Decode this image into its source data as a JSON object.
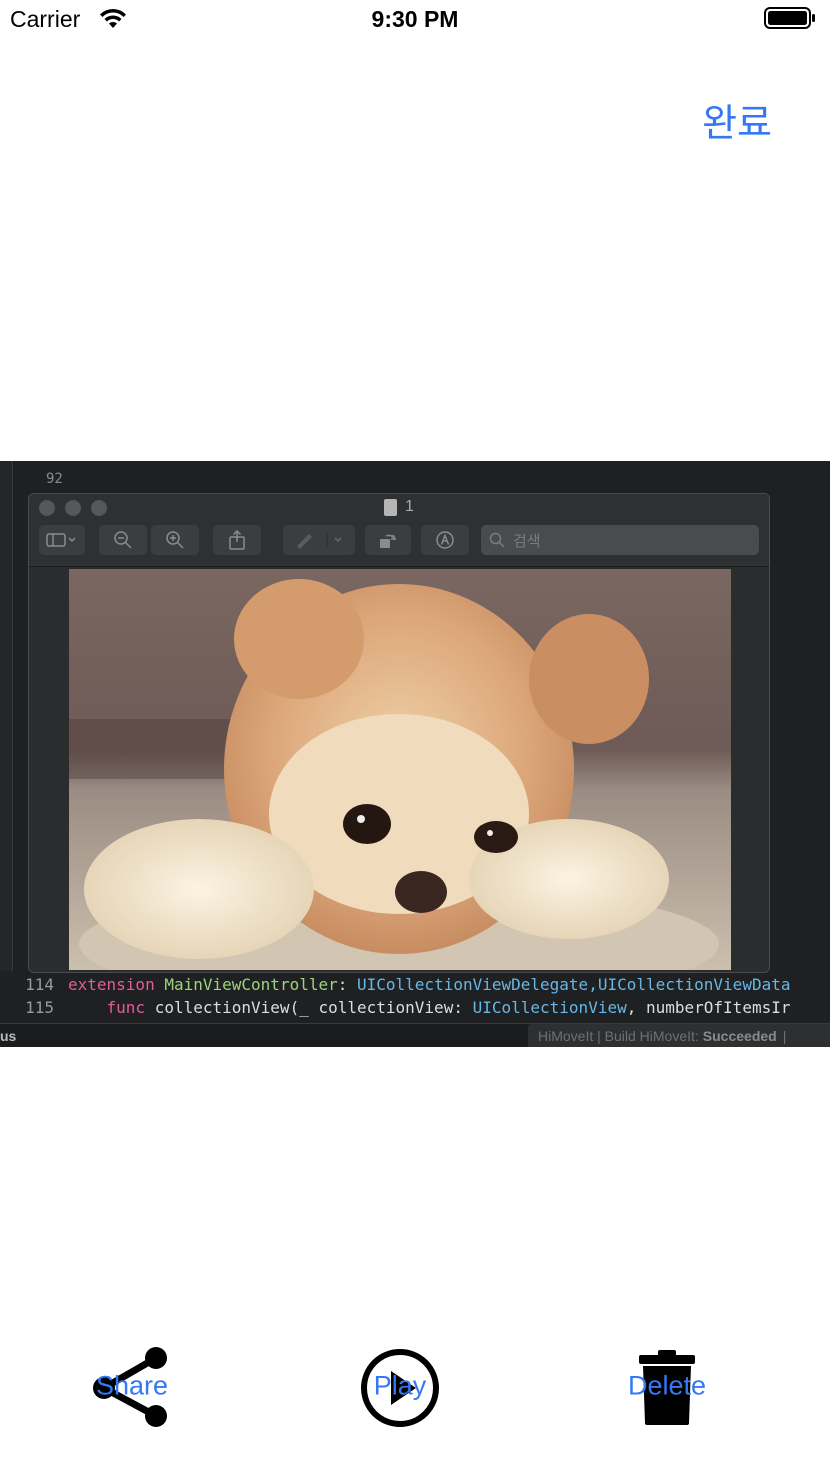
{
  "status_bar": {
    "carrier": "Carrier",
    "time": "9:30 PM"
  },
  "nav": {
    "done_label": "완료"
  },
  "media_screenshot": {
    "top_line_number": "92",
    "document_title": "1",
    "search_placeholder": "검색",
    "code_lines": [
      {
        "number": "114",
        "keyword": "extension",
        "type_name": "MainViewController",
        "sep": ": ",
        "protocols": "UICollectionViewDelegate,UICollectionViewData"
      },
      {
        "number": "115",
        "keyword": "func",
        "text": "collectionView(_ collectionView: ",
        "type_name": "UICollectionView",
        "rest": ", numberOfItemsIr"
      }
    ],
    "left_status_label": "us",
    "build_status_prefix": "HiMoveIt | Build HiMoveIt:",
    "build_status_result": "Succeeded",
    "build_status_suffix": "|"
  },
  "toolbar": {
    "share_label": "Share",
    "play_label": "Play",
    "delete_label": "Delete"
  },
  "colors": {
    "accent": "#3478f6",
    "icon": "#000000"
  }
}
